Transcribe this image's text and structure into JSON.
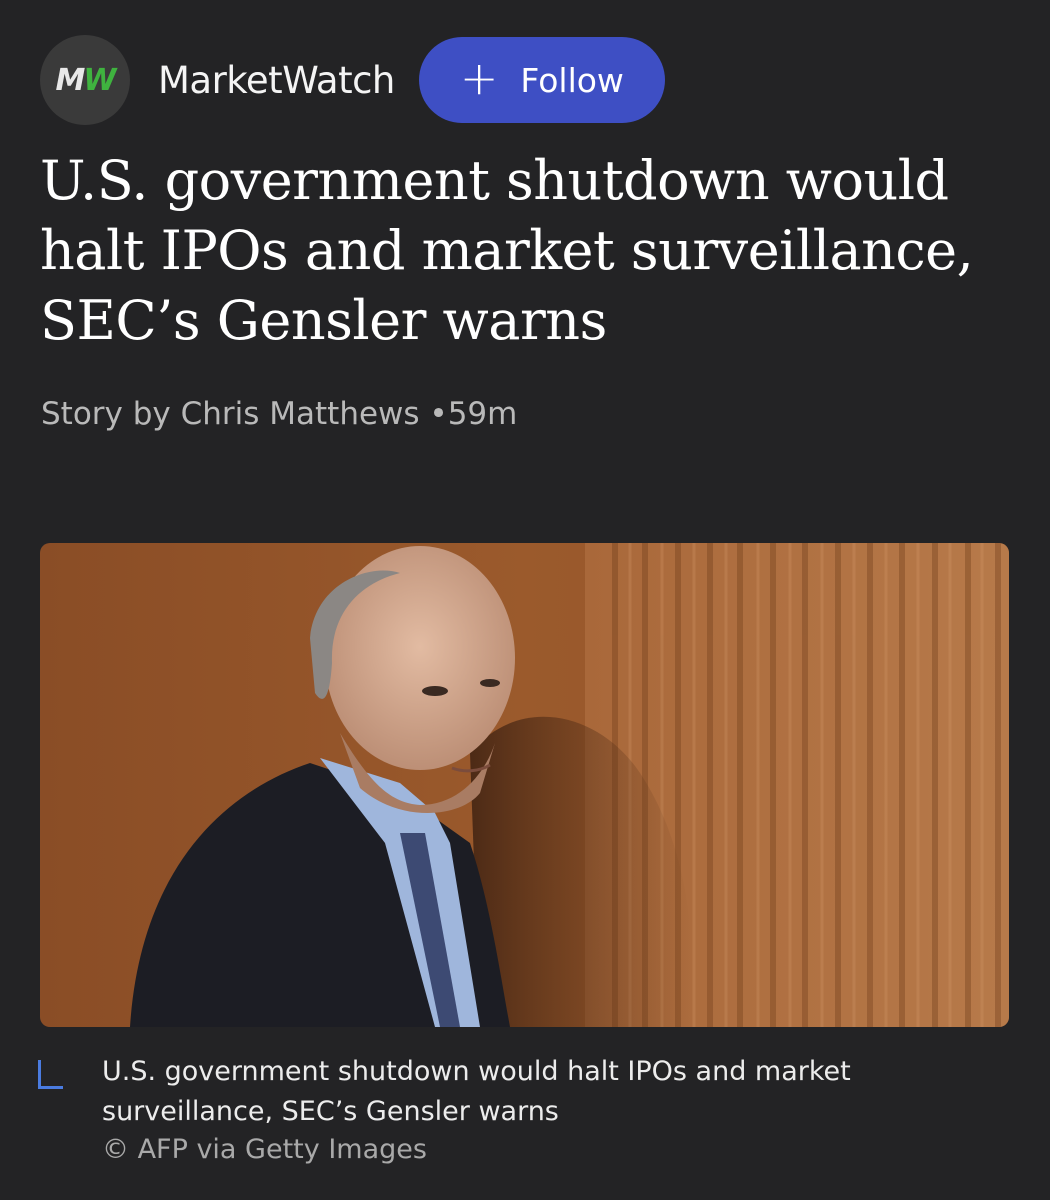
{
  "publisher": {
    "logo_text_m": "M",
    "logo_text_w": "W",
    "name": "MarketWatch",
    "follow_icon": "plus-icon",
    "follow_label": "Follow"
  },
  "article": {
    "headline": "U.S. government shutdown would halt IPOs and market surveillance, SEC’s Gensler warns",
    "byline": "Story by Chris Matthews •59m"
  },
  "image": {
    "caption": "U.S. government shutdown would halt IPOs and market surveillance, SEC’s Gensler warns",
    "credit": "© AFP via Getty Images"
  },
  "colors": {
    "background": "#232325",
    "follow_button": "#3e4fc4",
    "caption_marker": "#4a7be0",
    "logo_accent": "#3fb33f"
  }
}
